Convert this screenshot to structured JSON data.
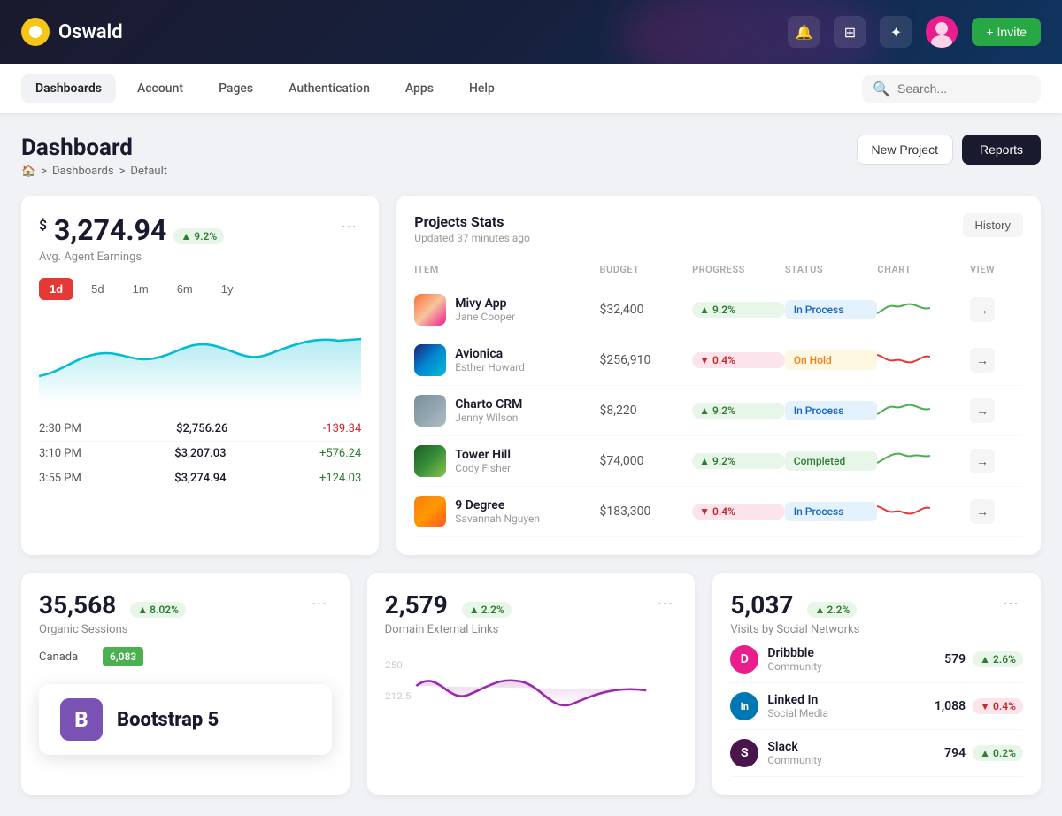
{
  "header": {
    "logo_text": "Oswald",
    "invite_label": "+ Invite"
  },
  "nav": {
    "items": [
      {
        "label": "Dashboards",
        "active": true
      },
      {
        "label": "Account",
        "active": false
      },
      {
        "label": "Pages",
        "active": false
      },
      {
        "label": "Authentication",
        "active": false
      },
      {
        "label": "Apps",
        "active": false
      },
      {
        "label": "Help",
        "active": false
      }
    ],
    "search_placeholder": "Search..."
  },
  "page": {
    "title": "Dashboard",
    "breadcrumb": [
      "🏠",
      "Dashboards",
      "Default"
    ],
    "actions": {
      "new_project": "New Project",
      "reports": "Reports"
    }
  },
  "earnings": {
    "dollar": "$",
    "amount": "3,274.94",
    "badge": "9.2%",
    "label": "Avg. Agent Earnings",
    "time_filters": [
      "1d",
      "5d",
      "1m",
      "6m",
      "1y"
    ],
    "active_filter": "1d",
    "rows": [
      {
        "time": "2:30 PM",
        "amount": "$2,756.26",
        "change": "-139.34",
        "positive": false
      },
      {
        "time": "3:10 PM",
        "amount": "$3,207.03",
        "change": "+576.24",
        "positive": true
      },
      {
        "time": "3:55 PM",
        "amount": "$3,274.94",
        "change": "+124.03",
        "positive": true
      }
    ]
  },
  "projects": {
    "title": "Projects Stats",
    "subtitle": "Updated 37 minutes ago",
    "history_btn": "History",
    "columns": [
      "ITEM",
      "BUDGET",
      "PROGRESS",
      "STATUS",
      "CHART",
      "VIEW"
    ],
    "rows": [
      {
        "name": "Mivy App",
        "owner": "Jane Cooper",
        "budget": "$32,400",
        "progress": "9.2%",
        "progress_pos": true,
        "status": "In Process",
        "status_class": "inprocess",
        "chart_color": "green"
      },
      {
        "name": "Avionica",
        "owner": "Esther Howard",
        "budget": "$256,910",
        "progress": "0.4%",
        "progress_pos": false,
        "status": "On Hold",
        "status_class": "onhold",
        "chart_color": "red"
      },
      {
        "name": "Charto CRM",
        "owner": "Jenny Wilson",
        "budget": "$8,220",
        "progress": "9.2%",
        "progress_pos": true,
        "status": "In Process",
        "status_class": "inprocess",
        "chart_color": "green"
      },
      {
        "name": "Tower Hill",
        "owner": "Cody Fisher",
        "budget": "$74,000",
        "progress": "9.2%",
        "progress_pos": true,
        "status": "Completed",
        "status_class": "completed",
        "chart_color": "green"
      },
      {
        "name": "9 Degree",
        "owner": "Savannah Nguyen",
        "budget": "$183,300",
        "progress": "0.4%",
        "progress_pos": false,
        "status": "In Process",
        "status_class": "inprocess",
        "chart_color": "red"
      }
    ]
  },
  "organic_sessions": {
    "value": "35,568",
    "badge": "8.02%",
    "label": "Organic Sessions",
    "geo_rows": [
      {
        "country": "Canada",
        "value": "6,083"
      }
    ]
  },
  "domain_links": {
    "value": "2,579",
    "badge": "2.2%",
    "label": "Domain External Links"
  },
  "social_networks": {
    "value": "5,037",
    "badge": "2.2%",
    "label": "Visits by Social Networks",
    "networks": [
      {
        "name": "Dribbble",
        "type": "Community",
        "count": "579",
        "change": "2.6%",
        "pos": true,
        "color": "#e91e8c",
        "letter": "D"
      },
      {
        "name": "Linked In",
        "type": "Social Media",
        "count": "1,088",
        "change": "0.4%",
        "pos": false,
        "color": "#0077b5",
        "letter": "in"
      },
      {
        "name": "Slack",
        "type": "Community",
        "count": "794",
        "change": "0.2%",
        "pos": true,
        "color": "#4a154b",
        "letter": "S"
      }
    ]
  },
  "bootstrap": {
    "icon": "B",
    "text": "Bootstrap 5"
  }
}
